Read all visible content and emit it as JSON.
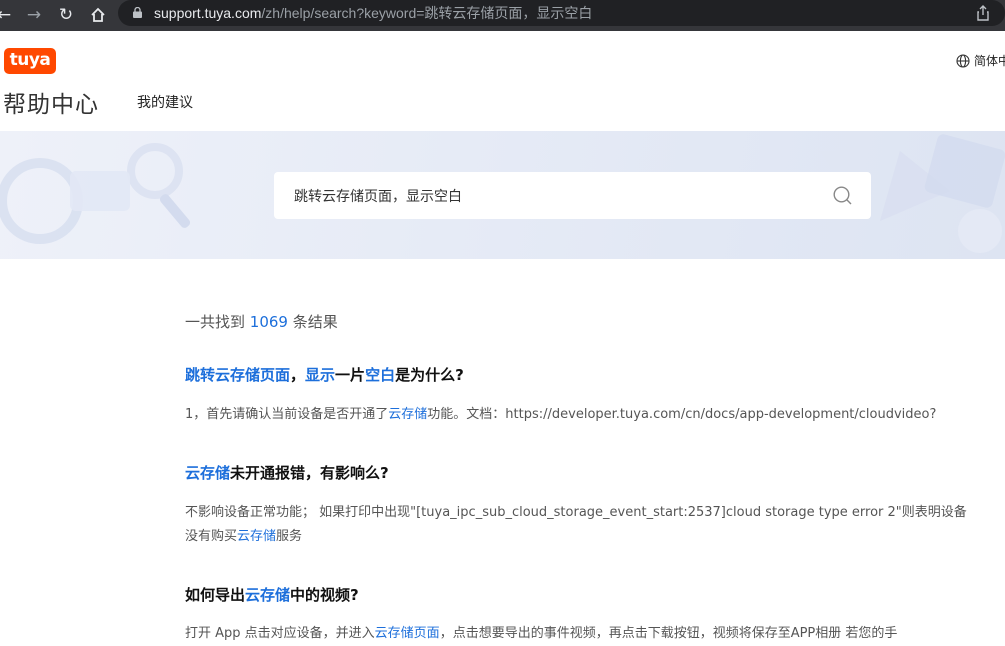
{
  "browser": {
    "url_host": "support.tuya.com",
    "url_path": "/zh/help/search?keyword=跳转云存储页面，显示空白"
  },
  "header": {
    "logo_text": "tuya",
    "title": "帮助中心",
    "nav_suggest": "我的建议",
    "language": "简体中"
  },
  "search": {
    "value": "跳转云存储页面，显示空白"
  },
  "results": {
    "count_prefix": "一共找到 ",
    "count": "1069",
    "count_suffix": " 条结果",
    "items": [
      {
        "title_parts": [
          {
            "text": "跳转云存储页面",
            "hl": true
          },
          {
            "text": "，",
            "hl": false
          },
          {
            "text": "显示",
            "hl": true
          },
          {
            "text": "一片",
            "hl": false
          },
          {
            "text": "空白",
            "hl": true
          },
          {
            "text": "是为什么?",
            "hl": false
          }
        ],
        "snippet_parts": [
          {
            "text": "1，首先请确认当前设备是否开通了",
            "hl": false
          },
          {
            "text": "云存储",
            "hl": true
          },
          {
            "text": "功能。文档：https://developer.tuya.com/cn/docs/app-development/cloudvideo?",
            "hl": false
          }
        ]
      },
      {
        "title_parts": [
          {
            "text": "云存储",
            "hl": true
          },
          {
            "text": "未开通报错，有影响么?",
            "hl": false
          }
        ],
        "snippet_parts": [
          {
            "text": "不影响设备正常功能； 如果打印中出现\"[tuya_ipc_sub_cloud_storage_event_start:2537]cloud storage type error 2\"则表明设备没有购买",
            "hl": false
          },
          {
            "text": "云存储",
            "hl": true
          },
          {
            "text": "服务",
            "hl": false
          }
        ]
      },
      {
        "title_parts": [
          {
            "text": "如何导出",
            "hl": false
          },
          {
            "text": "云存储",
            "hl": true
          },
          {
            "text": "中的视频?",
            "hl": false
          }
        ],
        "snippet_parts": [
          {
            "text": "打开 App 点击对应设备，并进入",
            "hl": false
          },
          {
            "text": "云存储页面",
            "hl": true
          },
          {
            "text": "，点击想要导出的事件视频，再点击下载按钮，视频将保存至APP相册 若您的手",
            "hl": false
          }
        ]
      }
    ]
  },
  "colors": {
    "accent": "#1d6fdb",
    "brand": "#ff4800"
  }
}
